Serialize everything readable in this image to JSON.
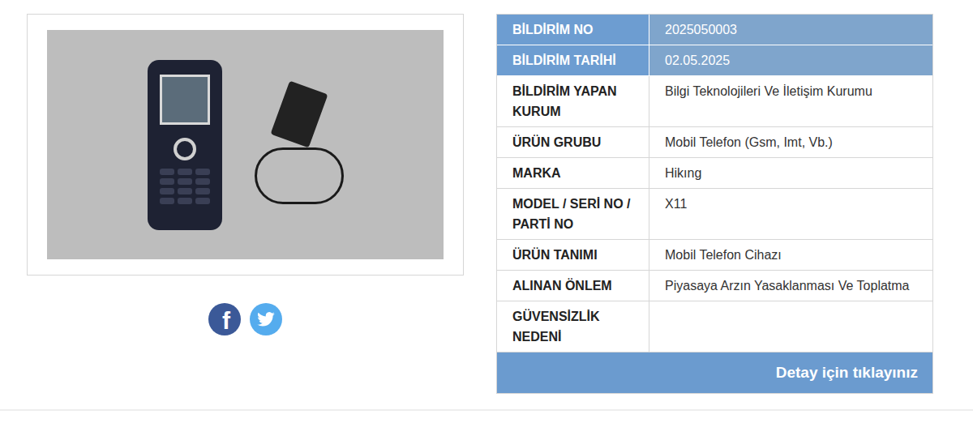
{
  "social": {
    "facebook": {
      "glyph": "f"
    }
  },
  "record": {
    "rows": [
      {
        "label": "BİLDİRİM NO",
        "value": "2025050003",
        "kind": "header"
      },
      {
        "label": "BİLDİRİM TARİHİ",
        "value": "02.05.2025",
        "kind": "header"
      },
      {
        "label": "BİLDİRİM YAPAN KURUM",
        "value": "Bilgi Teknolojileri Ve İletişim Kurumu",
        "kind": "body"
      },
      {
        "label": "ÜRÜN GRUBU",
        "value": "Mobil Telefon (Gsm, Imt, Vb.)",
        "kind": "body"
      },
      {
        "label": "MARKA",
        "value": "Hikıng",
        "kind": "body"
      },
      {
        "label": "MODEL / SERİ NO / PARTİ NO",
        "value": "X11",
        "kind": "body"
      },
      {
        "label": "ÜRÜN TANIMI",
        "value": "Mobil Telefon Cihazı",
        "kind": "body"
      },
      {
        "label": "ALINAN ÖNLEM",
        "value": "Piyasaya Arzın Yasaklanması Ve Toplatma",
        "kind": "body"
      },
      {
        "label": "GÜVENSİZLİK NEDENİ",
        "value": "",
        "kind": "body"
      }
    ],
    "detail_button": "Detay için tıklayınız"
  }
}
